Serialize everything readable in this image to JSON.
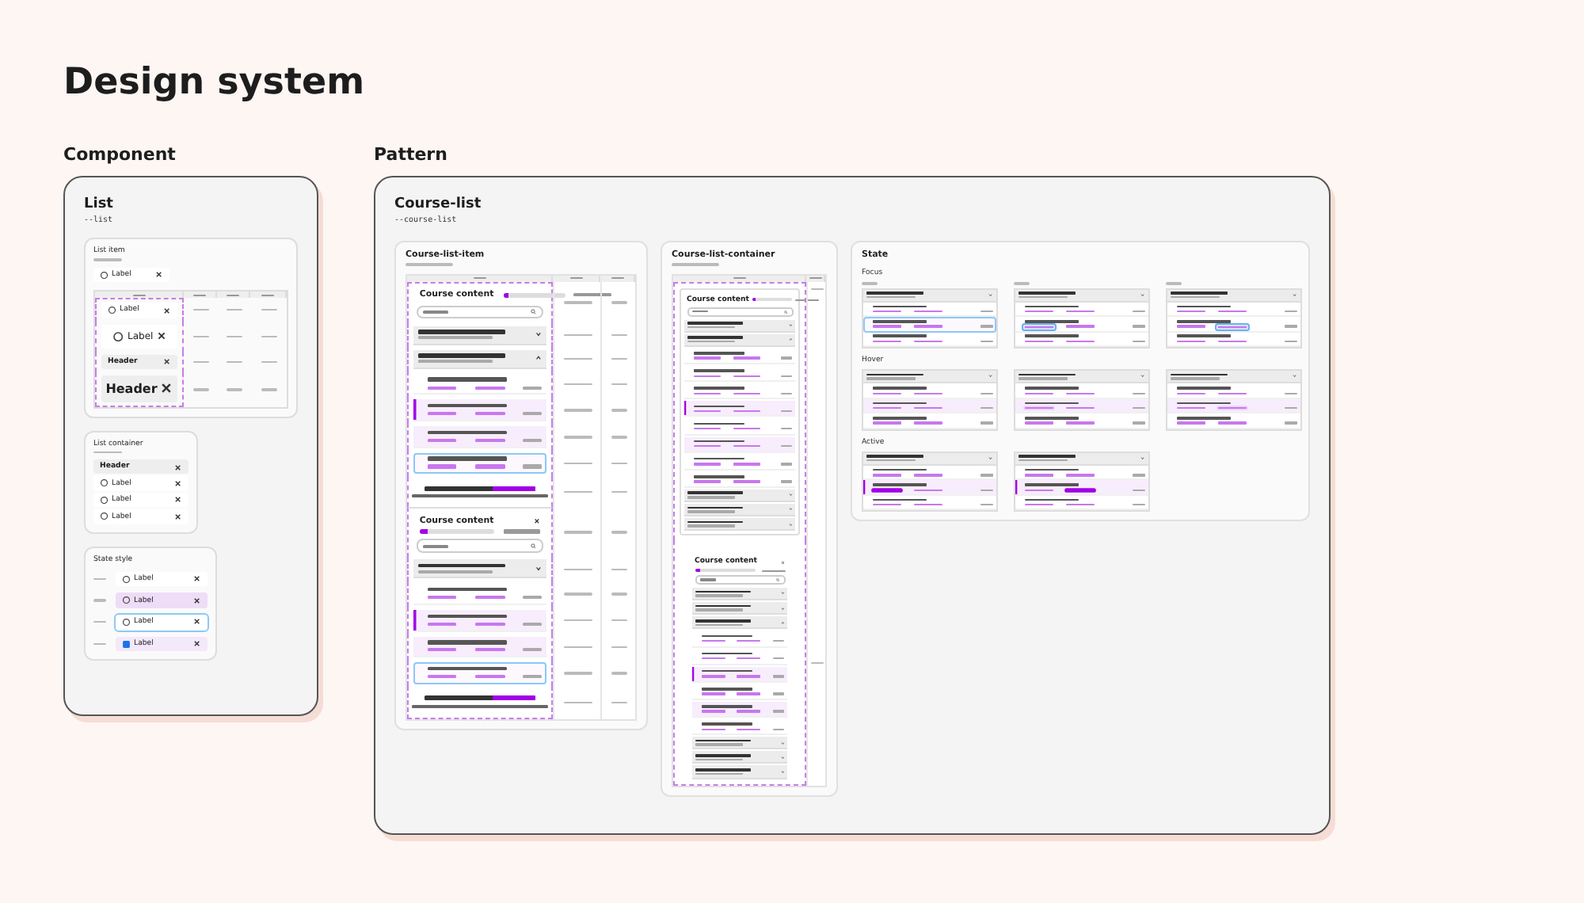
{
  "title": "Design system",
  "component": {
    "heading": "Component",
    "card": {
      "title": "List",
      "token": "--list",
      "list_item": {
        "title": "List item",
        "sample": {
          "kind": "label",
          "label": "Label"
        },
        "rows": [
          {
            "item": {
              "kind": "label",
              "label": "Label"
            }
          },
          {
            "item": {
              "kind": "label-large",
              "label": "Label"
            }
          },
          {
            "item": {
              "kind": "header",
              "label": "Header"
            }
          },
          {
            "item": {
              "kind": "header-large",
              "label": "Header"
            }
          }
        ]
      },
      "list_container": {
        "title": "List container",
        "items": [
          {
            "kind": "header",
            "label": "Header"
          },
          {
            "kind": "label",
            "label": "Label"
          },
          {
            "kind": "label",
            "label": "Label"
          },
          {
            "kind": "label",
            "label": "Label"
          }
        ]
      },
      "state_style": {
        "title": "State style",
        "rows": [
          {
            "kind": "default",
            "label": "Label"
          },
          {
            "kind": "hover",
            "label": "Label"
          },
          {
            "kind": "focus",
            "label": "Label"
          },
          {
            "kind": "active",
            "label": "Label"
          }
        ]
      }
    }
  },
  "pattern": {
    "heading": "Pattern",
    "card": {
      "title": "Course-list",
      "token": "--course-list",
      "item_panel": {
        "title": "Course-list-item",
        "rows": [
          {
            "entries": [
              {
                "kind": "content-header",
                "title": "Course content",
                "level": 0.1
              },
              {
                "kind": "search"
              }
            ]
          },
          {
            "entries": [
              {
                "kind": "section",
                "expanded": false
              }
            ]
          },
          {
            "entries": [
              {
                "kind": "section",
                "expanded": true
              }
            ]
          },
          {
            "entries": [
              {
                "kind": "module"
              }
            ]
          },
          {
            "entries": [
              {
                "kind": "module-selected"
              }
            ]
          },
          {
            "entries": [
              {
                "kind": "module-hover"
              }
            ]
          },
          {
            "entries": [
              {
                "kind": "module-focus"
              }
            ]
          },
          {
            "entries": [
              {
                "kind": "no-results"
              }
            ]
          },
          {
            "entries": [
              {
                "kind": "content-header-stacked",
                "title": "Course content",
                "level": 0.1
              },
              {
                "kind": "search"
              }
            ]
          },
          {
            "entries": [
              {
                "kind": "section",
                "expanded": false
              }
            ]
          },
          {
            "entries": [
              {
                "kind": "module"
              }
            ]
          },
          {
            "entries": [
              {
                "kind": "module-selected"
              }
            ]
          },
          {
            "entries": [
              {
                "kind": "module-hover"
              }
            ]
          },
          {
            "entries": [
              {
                "kind": "module-focus"
              }
            ]
          },
          {
            "entries": [
              {
                "kind": "no-results"
              }
            ]
          }
        ]
      },
      "container_panel": {
        "title": "Course-list-container",
        "rows": [
          {
            "kind": "card",
            "entries": [
              {
                "kind": "content-header",
                "title": "Course content",
                "level": 0.1
              },
              {
                "kind": "search"
              },
              {
                "kind": "section",
                "expanded": false
              },
              {
                "kind": "section",
                "expanded": true
              },
              {
                "kind": "module"
              },
              {
                "kind": "module"
              },
              {
                "kind": "module"
              },
              {
                "kind": "module-selected"
              },
              {
                "kind": "module"
              },
              {
                "kind": "module-hover"
              },
              {
                "kind": "module"
              },
              {
                "kind": "module"
              },
              {
                "kind": "section",
                "expanded": false
              },
              {
                "kind": "section",
                "expanded": false
              },
              {
                "kind": "section",
                "expanded": false
              }
            ]
          },
          {
            "kind": "plain",
            "entries": [
              {
                "kind": "content-header-stacked",
                "title": "Course content",
                "level": 0.1
              },
              {
                "kind": "search"
              },
              {
                "kind": "section",
                "expanded": false
              },
              {
                "kind": "section",
                "expanded": false
              },
              {
                "kind": "section",
                "expanded": true
              },
              {
                "kind": "module"
              },
              {
                "kind": "module"
              },
              {
                "kind": "module-selected"
              },
              {
                "kind": "module"
              },
              {
                "kind": "module-hover"
              },
              {
                "kind": "module"
              },
              {
                "kind": "section",
                "expanded": false
              },
              {
                "kind": "section",
                "expanded": false
              },
              {
                "kind": "section",
                "expanded": false
              }
            ]
          }
        ]
      },
      "state_panel": {
        "title": "State",
        "groups": [
          {
            "title": "Focus",
            "cards": [
              {
                "kind": "labeled",
                "entries": [
                  {
                    "kind": "section",
                    "expanded": false
                  },
                  {
                    "kind": "module"
                  },
                  {
                    "kind": "module-focus"
                  },
                  {
                    "kind": "module"
                  }
                ]
              },
              {
                "kind": "labeled",
                "entries": [
                  {
                    "kind": "section",
                    "expanded": false
                  },
                  {
                    "kind": "module"
                  },
                  {
                    "kind": "module-resources-focus"
                  },
                  {
                    "kind": "module"
                  }
                ]
              },
              {
                "kind": "labeled",
                "entries": [
                  {
                    "kind": "section",
                    "expanded": false
                  },
                  {
                    "kind": "module"
                  },
                  {
                    "kind": "module-exercise-focus"
                  },
                  {
                    "kind": "module"
                  }
                ]
              }
            ]
          },
          {
            "title": "Hover",
            "cards": [
              {
                "kind": "plain",
                "entries": [
                  {
                    "kind": "section",
                    "expanded": false
                  },
                  {
                    "kind": "module"
                  },
                  {
                    "kind": "module-hover"
                  },
                  {
                    "kind": "module"
                  }
                ]
              },
              {
                "kind": "plain",
                "entries": [
                  {
                    "kind": "section",
                    "expanded": false
                  },
                  {
                    "kind": "module"
                  },
                  {
                    "kind": "module-hover-resources"
                  },
                  {
                    "kind": "module"
                  }
                ]
              },
              {
                "kind": "plain",
                "entries": [
                  {
                    "kind": "section",
                    "expanded": false
                  },
                  {
                    "kind": "module"
                  },
                  {
                    "kind": "module-hover-exercise"
                  },
                  {
                    "kind": "module"
                  }
                ]
              }
            ]
          },
          {
            "title": "Active",
            "cards": [
              {
                "kind": "plain",
                "entries": [
                  {
                    "kind": "section",
                    "expanded": false
                  },
                  {
                    "kind": "module"
                  },
                  {
                    "kind": "module-active-resources"
                  },
                  {
                    "kind": "module"
                  }
                ]
              },
              {
                "kind": "plain",
                "entries": [
                  {
                    "kind": "section",
                    "expanded": false
                  },
                  {
                    "kind": "module"
                  },
                  {
                    "kind": "module-active-exercise"
                  },
                  {
                    "kind": "module"
                  }
                ]
              }
            ]
          }
        ]
      }
    }
  }
}
